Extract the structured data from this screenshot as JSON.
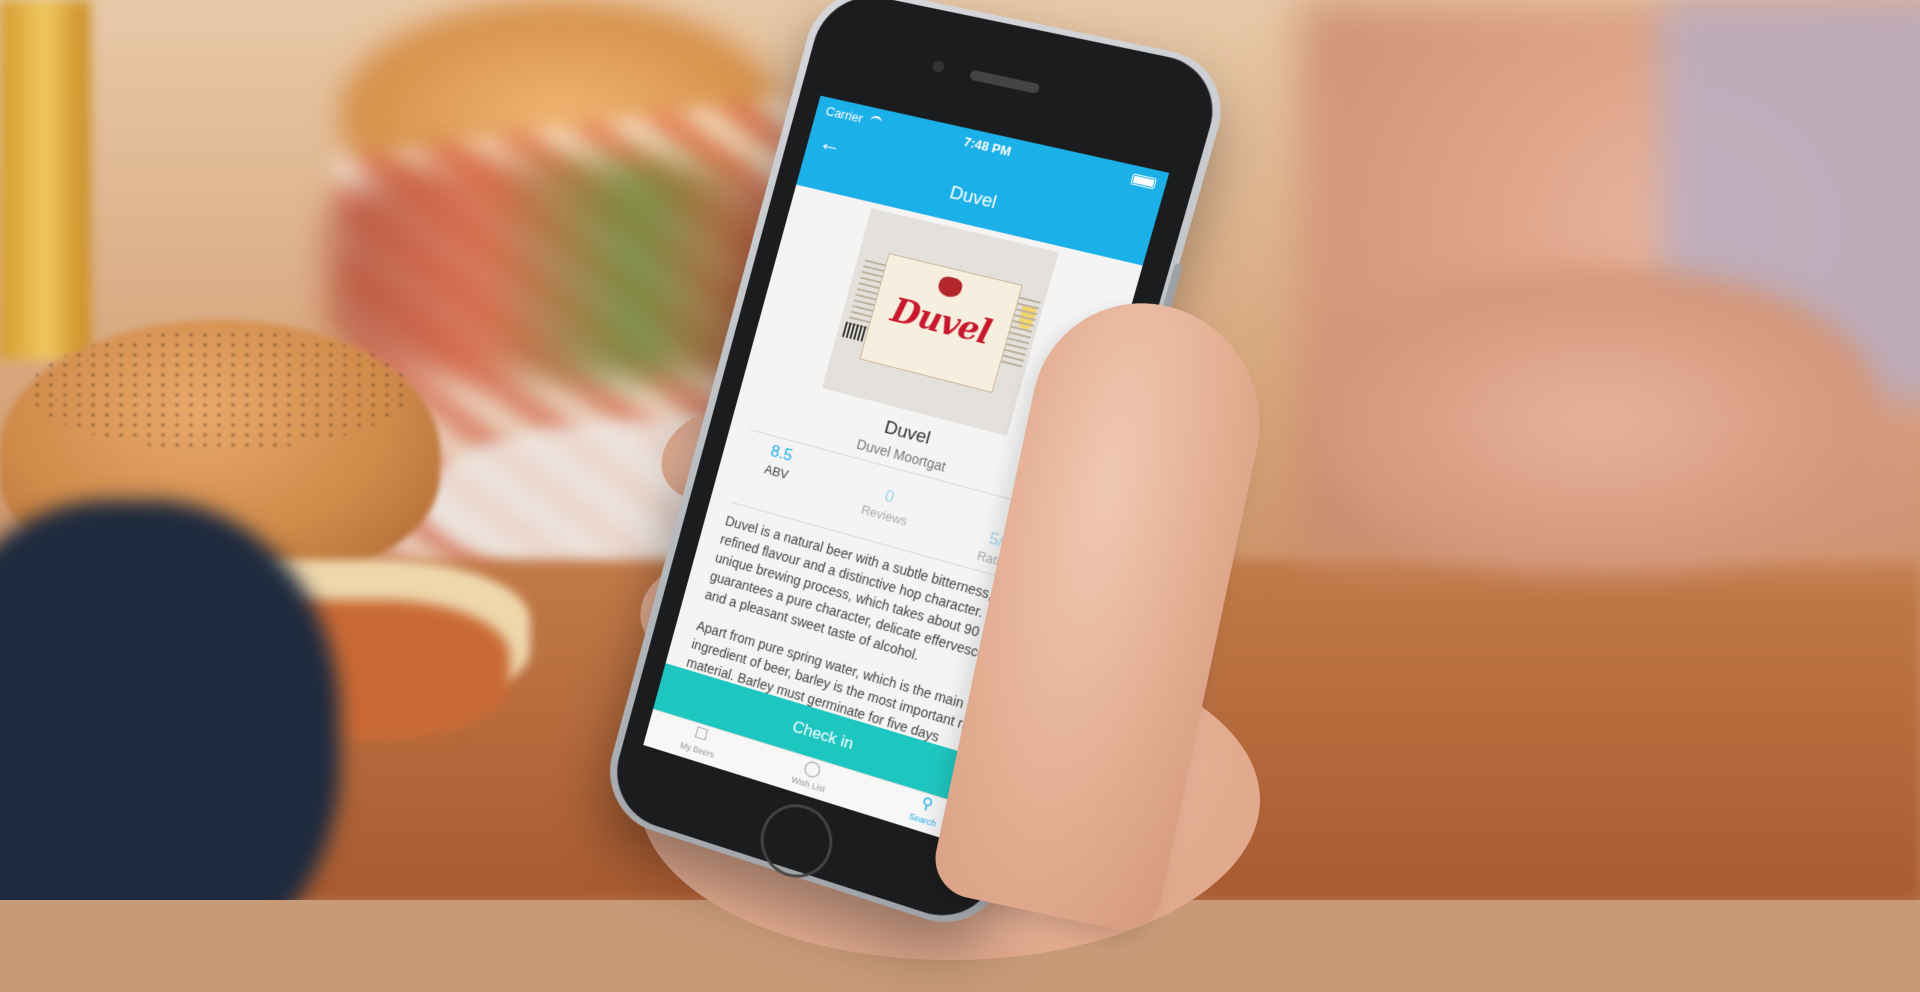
{
  "status_bar": {
    "carrier": "Carrier",
    "time": "7:48 PM"
  },
  "nav": {
    "back_icon": "arrow-left-icon",
    "title": "Duvel"
  },
  "beer": {
    "label_text": "Duvel",
    "name": "Duvel",
    "brewery": "Duvel Moortgat"
  },
  "stats": [
    {
      "value": "8.5",
      "label": "ABV"
    },
    {
      "value": "0",
      "label": "Reviews"
    },
    {
      "value": "5/5",
      "label": "Rating"
    }
  ],
  "description": [
    "Duvel is a natural beer with a subtle bitterness, a refined flavour and a distinctive hop character. The unique brewing process, which takes about 90 days, guarantees a pure character, delicate effervescence and a pleasant sweet taste of alcohol.",
    "Apart from pure spring water, which is the main ingredient of beer, barley is the most important raw material. Barley must germinate for five days"
  ],
  "checkin_label": "Check in",
  "tabs": [
    {
      "icon": "beer-glass-icon",
      "label": "My Beers"
    },
    {
      "icon": "wine-glass-icon",
      "label": "Wish List"
    },
    {
      "icon": "search-icon",
      "label": "Search"
    }
  ],
  "colors": {
    "primary": "#1cb0e8",
    "checkin": "#1ec6c0",
    "label_red": "#c8192c"
  }
}
